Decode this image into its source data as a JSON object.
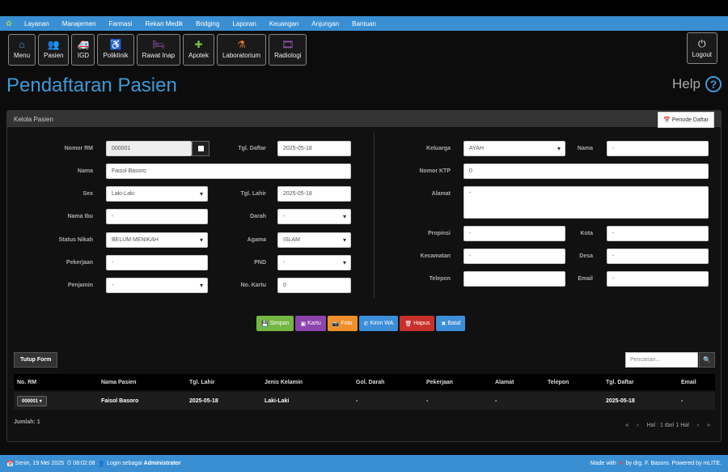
{
  "nav": [
    "Layanan",
    "Manajemen",
    "Farmasi",
    "Rekan Medik",
    "Bridging",
    "Laporan",
    "Keuangan",
    "Anjungan",
    "Bantuan"
  ],
  "iconbar": [
    {
      "label": "Menu",
      "icon": "home-icon",
      "glyph": "⌂",
      "color": "#4aa3e6"
    },
    {
      "label": "Pasien",
      "icon": "users-icon",
      "glyph": "👥",
      "color": "#7fc241"
    },
    {
      "label": "IGD",
      "icon": "ambulance-icon",
      "glyph": "🚑",
      "color": "#e74c3c"
    },
    {
      "label": "Poliklinik",
      "icon": "wheelchair-icon",
      "glyph": "♿",
      "color": "#f39c12"
    },
    {
      "label": "Rawat Inap",
      "icon": "bed-icon",
      "glyph": "🛏",
      "color": "#9b59b6"
    },
    {
      "label": "Apotek",
      "icon": "medkit-icon",
      "glyph": "✚",
      "color": "#7fc241"
    },
    {
      "label": "Laboratorium",
      "icon": "flask-icon",
      "glyph": "⚗",
      "color": "#e67e22"
    },
    {
      "label": "Radiologi",
      "icon": "film-icon",
      "glyph": "🎞",
      "color": "#9b59b6"
    }
  ],
  "logout": {
    "label": "Logout",
    "glyph": "⏻"
  },
  "page": {
    "title": "Pendaftaran Pasien",
    "help": "Help",
    "help_glyph": "?"
  },
  "panel": {
    "title": "Kelola Pasien",
    "periode": "Periode Daftar"
  },
  "form": {
    "nomor_rm": {
      "label": "Nomor RM",
      "value": "000001"
    },
    "tgl_daftar": {
      "label": "Tgl. Daftar",
      "value": "2025-05-18"
    },
    "nama": {
      "label": "Nama",
      "value": "Faisol Basoro"
    },
    "sex": {
      "label": "Sex",
      "value": "Laki-Laki"
    },
    "tgl_lahir": {
      "label": "Tgl. Lahir",
      "value": "2025-05-18"
    },
    "nama_ibu": {
      "label": "Nama Ibu",
      "value": "-"
    },
    "darah": {
      "label": "Darah",
      "value": "-"
    },
    "status_nikah": {
      "label": "Status Nikah",
      "value": "BELUM MENIKAH"
    },
    "agama": {
      "label": "Agama",
      "value": "ISLAM"
    },
    "pekerjaan": {
      "label": "Pekerjaan",
      "value": "-"
    },
    "pnd": {
      "label": "PND",
      "value": "-"
    },
    "penjamin": {
      "label": "Penjamin",
      "value": "-"
    },
    "no_kartu": {
      "label": "No. Kartu",
      "value": "0"
    },
    "keluarga": {
      "label": "Keluarga",
      "value": "AYAH"
    },
    "nama_keluarga": {
      "label": "Nama",
      "value": "-"
    },
    "nomor_ktp": {
      "label": "Nomor KTP",
      "value": "0"
    },
    "alamat": {
      "label": "Alamat",
      "value": "-"
    },
    "propinsi": {
      "label": "Propinsi",
      "value": "-"
    },
    "kota": {
      "label": "Kota",
      "value": "-"
    },
    "kecamatan": {
      "label": "Kecamatan",
      "value": "-"
    },
    "desa": {
      "label": "Desa",
      "value": "-"
    },
    "telepon": {
      "label": "Telepon",
      "value": ""
    },
    "email": {
      "label": "Email",
      "value": "-"
    }
  },
  "actions": [
    {
      "label": "Simpan",
      "glyph": "💾",
      "color": "#74b743"
    },
    {
      "label": "Kartu",
      "glyph": "▣",
      "color": "#8e44ad"
    },
    {
      "label": "Foto",
      "glyph": "📷",
      "color": "#ef8f2b"
    },
    {
      "label": "Kirim WA",
      "glyph": "✆",
      "color": "#3d8ed8"
    },
    {
      "label": "Hapus",
      "glyph": "🗑",
      "color": "#c9302c"
    },
    {
      "label": "Batal",
      "glyph": "✖",
      "color": "#3d8ed8"
    }
  ],
  "tutup_form": "Tutup Form",
  "search": {
    "placeholder": "Pencarian..."
  },
  "table": {
    "columns": [
      "No. RM",
      "Nama Pasien",
      "Tgl. Lahir",
      "Jenis Kelamin",
      "Gol. Darah",
      "Pekerjaan",
      "Alamat",
      "Telepon",
      "Tgl. Daftar",
      "Email"
    ],
    "rows": [
      [
        "000001",
        "Faisol Basoro",
        "2025-05-18",
        "Laki-Laki",
        "-",
        "-",
        "-",
        "",
        "2025-05-18",
        "-"
      ]
    ]
  },
  "jumlah": "Jumlah: 1",
  "pager": {
    "first": "«",
    "prev": "‹",
    "info": "Hal : 1 dari 1 Hal",
    "next": "›",
    "last": "»"
  },
  "footer": {
    "date": "Senin, 19 Mei 2025",
    "time": "08:02:08",
    "login_prefix": "Login sebagai",
    "user": "Administrator",
    "made_with": "Made with",
    "by": "by drg. F. Basoro. Powered by mLITE."
  }
}
